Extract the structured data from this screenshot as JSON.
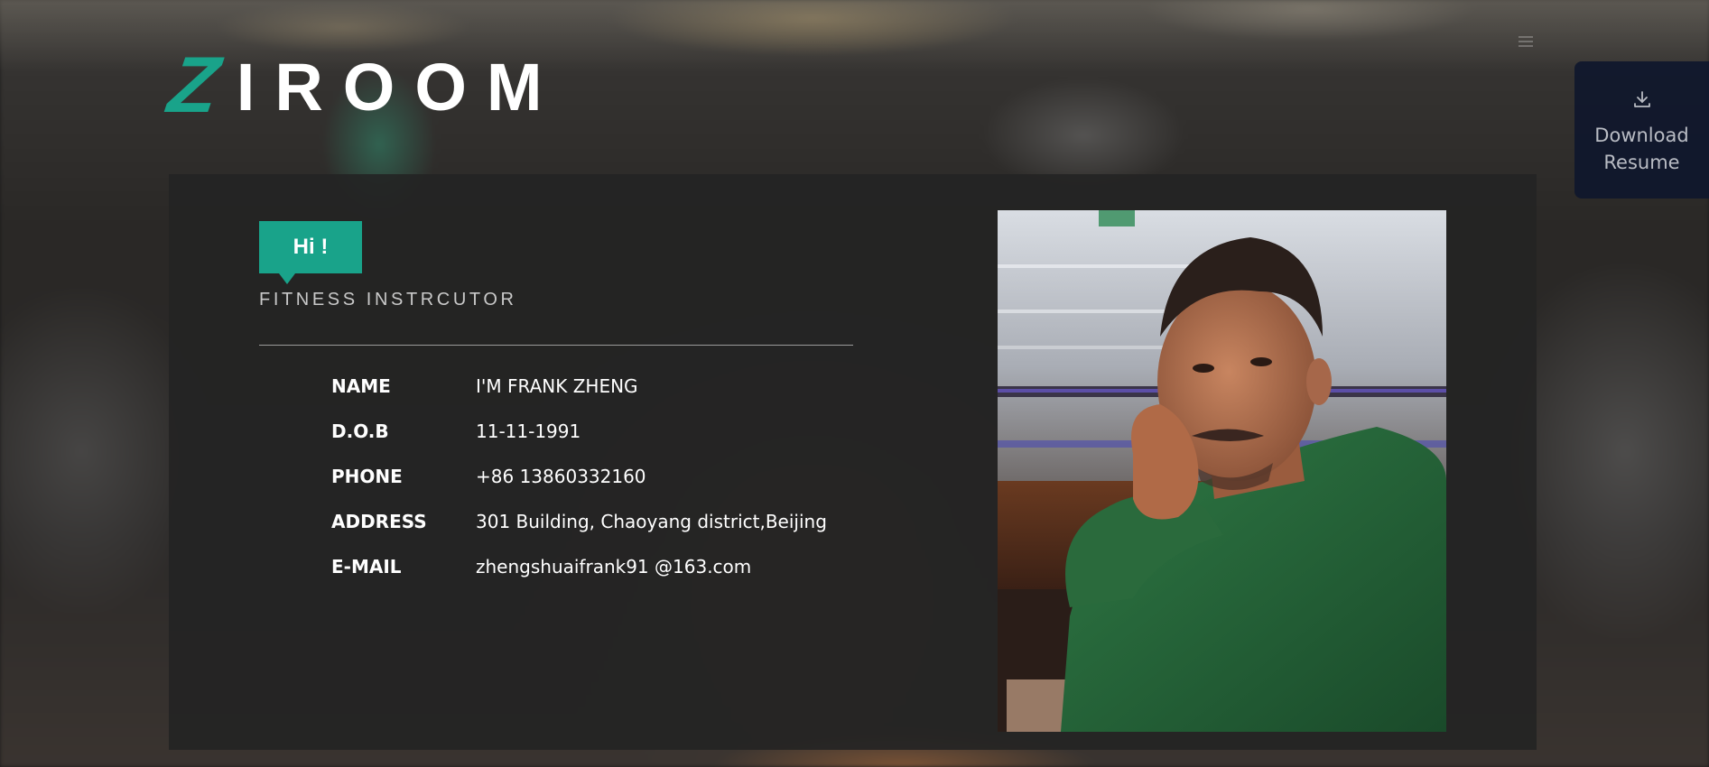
{
  "brand": {
    "logo_initial": "Z",
    "logo_rest": "IROOM",
    "accent_color": "#19a38a"
  },
  "header": {
    "menu_icon": "hamburger-menu-icon",
    "download_icon": "download-icon",
    "download_label": "Download Resume"
  },
  "profile": {
    "greeting": "Hi !",
    "role": "FITNESS INSTRCUTOR",
    "fields": [
      {
        "label": "NAME",
        "value": "I'M FRANK ZHENG"
      },
      {
        "label": "D.O.B",
        "value": "11-11-1991"
      },
      {
        "label": "PHONE",
        "value": "+86 13860332160"
      },
      {
        "label": "ADDRESS",
        "value": "301 Building, Chaoyang district,Beijing"
      },
      {
        "label": "E-MAIL",
        "value": "zhengshuaifrank91 @163.com"
      }
    ]
  }
}
